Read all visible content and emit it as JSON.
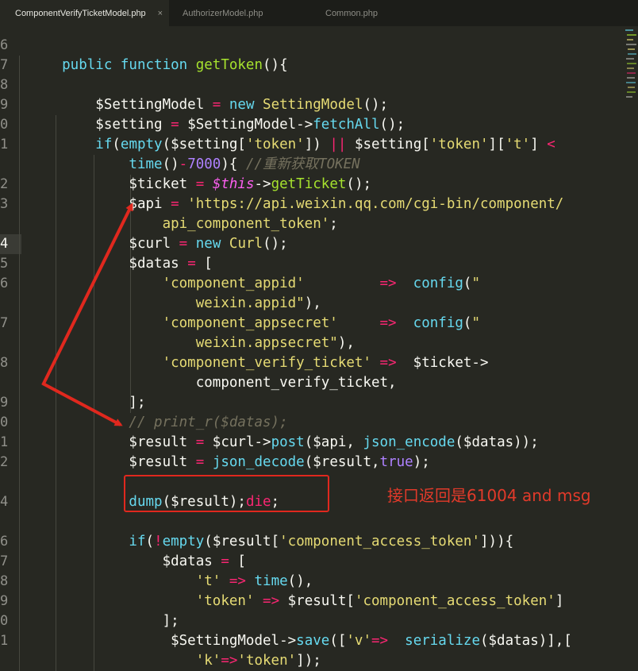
{
  "tabs": [
    {
      "label": "ComponentVerifyTicketModel.php",
      "active": true,
      "close": "×"
    },
    {
      "label": "AuthorizerModel.php",
      "active": false
    },
    {
      "label": "Common.php",
      "active": false
    }
  ],
  "gutter": [
    "6",
    "7",
    "8",
    "9",
    "0",
    "1",
    "",
    "2",
    "3",
    "",
    "4",
    "5",
    "6",
    "",
    "7",
    "",
    "8",
    "",
    "9",
    "0",
    "1",
    "2",
    "",
    "4",
    "",
    "6",
    "7",
    "8",
    "9",
    "0",
    "1",
    ""
  ],
  "current_line_index": 10,
  "annotation": {
    "box_label": "dump-highlight",
    "text": "接口返回是61004 and msg"
  },
  "colors": {
    "background": "#272822",
    "annotation_red": "#e0281e"
  },
  "code": [
    [],
    [
      [
        "kw",
        "    public function "
      ],
      [
        "fn",
        "getToken"
      ],
      [
        "var",
        "(){"
      ]
    ],
    [],
    [
      [
        "var",
        "        $SettingModel "
      ],
      [
        "op",
        "="
      ],
      [
        "var",
        " "
      ],
      [
        "kw",
        "new "
      ],
      [
        "cls",
        "SettingModel"
      ],
      [
        "var",
        "();"
      ]
    ],
    [
      [
        "var",
        "        $setting "
      ],
      [
        "op",
        "="
      ],
      [
        "var",
        " $SettingModel->"
      ],
      [
        "kw",
        "fetchAll"
      ],
      [
        "var",
        "();"
      ]
    ],
    [
      [
        "kw",
        "        if"
      ],
      [
        "var",
        "("
      ],
      [
        "kw",
        "empty"
      ],
      [
        "var",
        "($setting["
      ],
      [
        "str",
        "'token'"
      ],
      [
        "var",
        "]) "
      ],
      [
        "op",
        "||"
      ],
      [
        "var",
        " $setting["
      ],
      [
        "str",
        "'token'"
      ],
      [
        "var",
        "]["
      ],
      [
        "str",
        "'t'"
      ],
      [
        "var",
        "] "
      ],
      [
        "op",
        "<"
      ]
    ],
    [
      [
        "kw",
        "            time"
      ],
      [
        "var",
        "()"
      ],
      [
        "op",
        "-"
      ],
      [
        "num",
        "7000"
      ],
      [
        "var",
        "){ "
      ],
      [
        "cmt",
        "//重新获取TOKEN"
      ]
    ],
    [
      [
        "var",
        "            $ticket "
      ],
      [
        "op",
        "="
      ],
      [
        "var",
        " "
      ],
      [
        "this",
        "$this"
      ],
      [
        "var",
        "->"
      ],
      [
        "fn",
        "getTicket"
      ],
      [
        "var",
        "();"
      ]
    ],
    [
      [
        "var",
        "            $api "
      ],
      [
        "op",
        "="
      ],
      [
        "var",
        " "
      ],
      [
        "str",
        "'https://api.weixin.qq.com/cgi-bin/component/"
      ]
    ],
    [
      [
        "str",
        "                api_component_token'"
      ],
      [
        "var",
        ";"
      ]
    ],
    [
      [
        "var",
        "            $curl "
      ],
      [
        "op",
        "="
      ],
      [
        "var",
        " "
      ],
      [
        "kw",
        "new "
      ],
      [
        "cls",
        "Curl"
      ],
      [
        "var",
        "();"
      ]
    ],
    [
      [
        "var",
        "            $datas "
      ],
      [
        "op",
        "="
      ],
      [
        "var",
        " ["
      ]
    ],
    [
      [
        "str",
        "                'component_appid'"
      ],
      [
        "var",
        "         "
      ],
      [
        "op",
        "=>"
      ],
      [
        "var",
        "  "
      ],
      [
        "kw",
        "config"
      ],
      [
        "var",
        "("
      ],
      [
        "str",
        "\""
      ]
    ],
    [
      [
        "str",
        "                    weixin.appid\""
      ],
      [
        "var",
        "),"
      ]
    ],
    [
      [
        "str",
        "                'component_appsecret'"
      ],
      [
        "var",
        "     "
      ],
      [
        "op",
        "=>"
      ],
      [
        "var",
        "  "
      ],
      [
        "kw",
        "config"
      ],
      [
        "var",
        "("
      ],
      [
        "str",
        "\""
      ]
    ],
    [
      [
        "str",
        "                    weixin.appsecret\""
      ],
      [
        "var",
        "),"
      ]
    ],
    [
      [
        "str",
        "                'component_verify_ticket'"
      ],
      [
        "var",
        " "
      ],
      [
        "op",
        "=>"
      ],
      [
        "var",
        "  $ticket->"
      ]
    ],
    [
      [
        "var",
        "                    component_verify_ticket,"
      ]
    ],
    [
      [
        "var",
        "            ];"
      ]
    ],
    [
      [
        "cmt",
        "            // print_r($datas);"
      ]
    ],
    [
      [
        "var",
        "            $result "
      ],
      [
        "op",
        "="
      ],
      [
        "var",
        " $curl->"
      ],
      [
        "kw",
        "post"
      ],
      [
        "var",
        "($api, "
      ],
      [
        "kw",
        "json_encode"
      ],
      [
        "var",
        "($datas));"
      ]
    ],
    [
      [
        "var",
        "            $result "
      ],
      [
        "op",
        "="
      ],
      [
        "var",
        " "
      ],
      [
        "kw",
        "json_decode"
      ],
      [
        "var",
        "($result,"
      ],
      [
        "num",
        "true"
      ],
      [
        "var",
        ");"
      ]
    ],
    [],
    [
      [
        "kw",
        "            dump"
      ],
      [
        "var",
        "($result);"
      ],
      [
        "kwr",
        "die"
      ],
      [
        "var",
        ";"
      ]
    ],
    [],
    [
      [
        "kw",
        "            if"
      ],
      [
        "var",
        "("
      ],
      [
        "op",
        "!"
      ],
      [
        "kw",
        "empty"
      ],
      [
        "var",
        "($result["
      ],
      [
        "str",
        "'component_access_token'"
      ],
      [
        "var",
        "])){"
      ]
    ],
    [
      [
        "var",
        "                $datas "
      ],
      [
        "op",
        "="
      ],
      [
        "var",
        " ["
      ]
    ],
    [
      [
        "str",
        "                    't'"
      ],
      [
        "var",
        " "
      ],
      [
        "op",
        "=>"
      ],
      [
        "var",
        " "
      ],
      [
        "kw",
        "time"
      ],
      [
        "var",
        "(),"
      ]
    ],
    [
      [
        "str",
        "                    'token'"
      ],
      [
        "var",
        " "
      ],
      [
        "op",
        "=>"
      ],
      [
        "var",
        " $result["
      ],
      [
        "str",
        "'component_access_token'"
      ],
      [
        "var",
        "]"
      ]
    ],
    [
      [
        "var",
        "                ];"
      ]
    ],
    [
      [
        "var",
        "                 $SettingModel->"
      ],
      [
        "kw",
        "save"
      ],
      [
        "var",
        "(["
      ],
      [
        "str",
        "'v'"
      ],
      [
        "op",
        "=>"
      ],
      [
        "var",
        "  "
      ],
      [
        "kw",
        "serialize"
      ],
      [
        "var",
        "($datas)],["
      ]
    ],
    [
      [
        "str",
        "                    'k'"
      ],
      [
        "op",
        "=>"
      ],
      [
        "str",
        "'token'"
      ],
      [
        "var",
        "]);"
      ]
    ]
  ]
}
